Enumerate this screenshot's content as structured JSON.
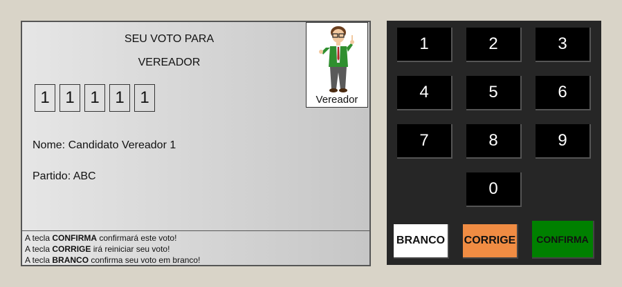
{
  "screen": {
    "title_line1": "SEU VOTO PARA",
    "title_line2": "VEREADOR",
    "digits": [
      "1",
      "1",
      "1",
      "1",
      "1"
    ],
    "photo_label": "Vereador",
    "name_label": "Nome: Candidato Vereador 1",
    "party_label": "Partido: ABC",
    "instructions": {
      "line1_pre": "A tecla ",
      "line1_key": "CONFIRMA",
      "line1_post": " confirmará este voto!",
      "line2_pre": "A tecla ",
      "line2_key": "CORRIGE",
      "line2_post": " irá reiniciar seu voto!",
      "line3_pre": "A tecla ",
      "line3_key": "BRANCO",
      "line3_post": " confirma seu voto em branco!"
    }
  },
  "keypad": {
    "keys": [
      "1",
      "2",
      "3",
      "4",
      "5",
      "6",
      "7",
      "8",
      "9",
      "0"
    ],
    "branco": "BRANCO",
    "corrige": "CORRIGE",
    "confirma": "CONFIRMA"
  },
  "colors": {
    "background": "#d9d4c8",
    "keypad_bg": "#262626",
    "branco": "#ffffff",
    "corrige": "#f08c43",
    "confirma": "#008000"
  }
}
